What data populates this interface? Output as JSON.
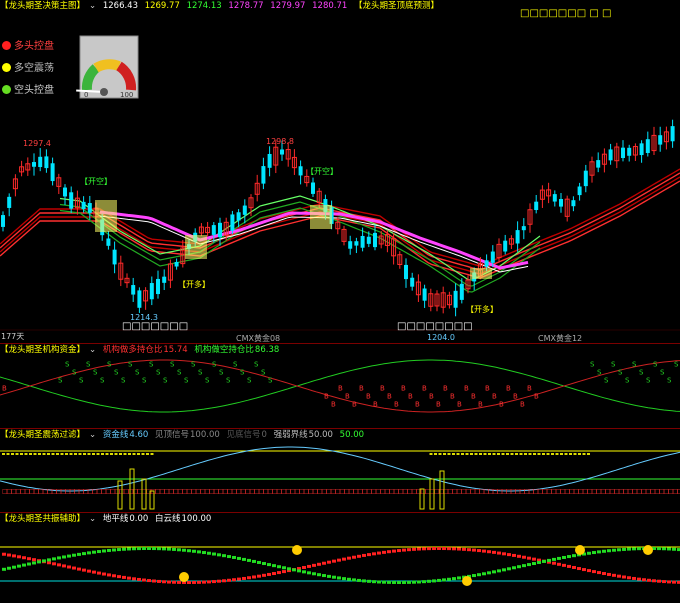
{
  "main": {
    "title": "【龙头期圣决策主图】",
    "ma_values": [
      {
        "value": "1266.43",
        "color": "#ffffff"
      },
      {
        "value": "1269.77",
        "color": "#ffff00"
      },
      {
        "value": "1274.13",
        "color": "#33ff33"
      },
      {
        "value": "1278.77",
        "color": "#ff44ff"
      },
      {
        "value": "1279.97",
        "color": "#ff44ff"
      },
      {
        "value": "1280.71",
        "color": "#ff44ff"
      }
    ],
    "top_label": "【龙头期圣顶底预测】",
    "top_boxes": "□□□□□□□   □   □",
    "legend": [
      {
        "label": "多头控盘",
        "color": "#ff2020"
      },
      {
        "label": "多空震荡",
        "color": "#ffff00"
      },
      {
        "label": "空头控盘",
        "color": "#66dd22"
      }
    ],
    "gauge_min": "0",
    "gauge_max": "100",
    "gauge_value": 0.04,
    "price_high_1": "1297.4",
    "price_high_2": "1298.8",
    "price_low_1": "1214.3",
    "price_low_2": "1204.0",
    "signal_short": "【开空】",
    "signal_long": "【开多】",
    "bottom_boxes_1": "□□□□□□□",
    "bottom_boxes_2": "□□□□□□□□",
    "days_label": "177天",
    "contract_1": "CMX黄金08",
    "contract_2": "CMX黄金12"
  },
  "panel2": {
    "title": "【龙头期圣机构资金】",
    "items": [
      {
        "label": "机构做多持仓比",
        "value": "15.74",
        "color": "#ff3030"
      },
      {
        "label": "机构做空持仓比",
        "value": "86.38",
        "color": "#33ff33"
      }
    ]
  },
  "panel3": {
    "title": "【龙头期圣震荡过滤】",
    "items": [
      {
        "label": "资金线",
        "value": "4.60",
        "color": "#66ccff"
      },
      {
        "label": "见顶信号",
        "value": "100.00",
        "color": "#888888"
      },
      {
        "label": "见底信号",
        "value": "0",
        "color": "#666666"
      },
      {
        "label": "强弱界线",
        "value": "50.00",
        "color": "#bbbbbb"
      },
      {
        "label": "",
        "value": "50.00",
        "color": "#33ff33"
      }
    ]
  },
  "panel4": {
    "title": "【龙头期圣共振辅助】",
    "items": [
      {
        "label": "地平线",
        "value": "0.00",
        "color": "#ffffff"
      },
      {
        "label": "白云线",
        "value": "100.00",
        "color": "#ffffff"
      }
    ]
  }
}
